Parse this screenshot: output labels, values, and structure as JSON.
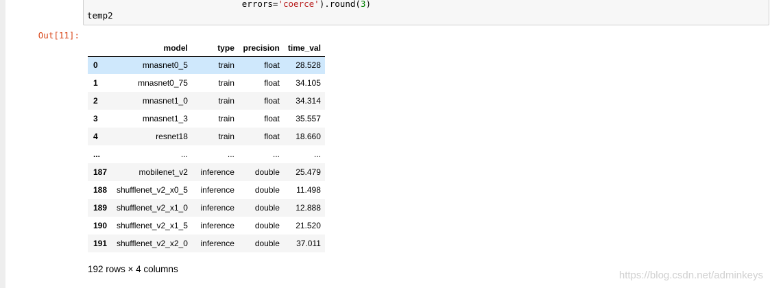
{
  "code": {
    "line1_indent": "                              ",
    "line1_prefix": "errors=",
    "line1_string": "'coerce'",
    "line1_mid": ").round(",
    "line1_num": "3",
    "line1_end": ")",
    "line2": "temp2"
  },
  "output": {
    "prompt": "Out[11]:",
    "columns": [
      "",
      "model",
      "type",
      "precision",
      "time_val"
    ],
    "rows": [
      {
        "index": "0",
        "model": "mnasnet0_5",
        "type": "train",
        "precision": "float",
        "time_val": "28.528"
      },
      {
        "index": "1",
        "model": "mnasnet0_75",
        "type": "train",
        "precision": "float",
        "time_val": "34.105"
      },
      {
        "index": "2",
        "model": "mnasnet1_0",
        "type": "train",
        "precision": "float",
        "time_val": "34.314"
      },
      {
        "index": "3",
        "model": "mnasnet1_3",
        "type": "train",
        "precision": "float",
        "time_val": "35.557"
      },
      {
        "index": "4",
        "model": "resnet18",
        "type": "train",
        "precision": "float",
        "time_val": "18.660"
      },
      {
        "index": "...",
        "model": "...",
        "type": "...",
        "precision": "...",
        "time_val": "..."
      },
      {
        "index": "187",
        "model": "mobilenet_v2",
        "type": "inference",
        "precision": "double",
        "time_val": "25.479"
      },
      {
        "index": "188",
        "model": "shufflenet_v2_x0_5",
        "type": "inference",
        "precision": "double",
        "time_val": "11.498"
      },
      {
        "index": "189",
        "model": "shufflenet_v2_x1_0",
        "type": "inference",
        "precision": "double",
        "time_val": "12.888"
      },
      {
        "index": "190",
        "model": "shufflenet_v2_x1_5",
        "type": "inference",
        "precision": "double",
        "time_val": "21.520"
      },
      {
        "index": "191",
        "model": "shufflenet_v2_x2_0",
        "type": "inference",
        "precision": "double",
        "time_val": "37.011"
      }
    ],
    "shape": "192 rows × 4 columns"
  },
  "watermark": "https://blog.csdn.net/adminkeys",
  "colors": {
    "prompt": "#d84315",
    "highlight_row": "#cfe8fc",
    "string_token": "#ba2121",
    "number_token": "#008000"
  }
}
